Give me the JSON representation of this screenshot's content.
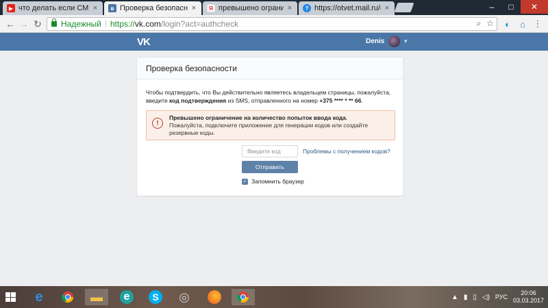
{
  "browser": {
    "tabs": [
      {
        "title": "что делать если СМС ко",
        "favicon_color": "#e62117",
        "active": false
      },
      {
        "title": "Проверка безопасност",
        "favicon_color": "#4a76a8",
        "active": true
      },
      {
        "title": "превышено ограничени",
        "favicon_color": "#ffffff",
        "active": false
      },
      {
        "title": "https://otvet.mail.ru/que",
        "favicon_color": "#1e88e5",
        "active": false
      }
    ],
    "tab_close": "×",
    "window": {
      "minimize": "–",
      "maximize": "□",
      "close": "✕"
    },
    "address": {
      "secure_label": "Надежный",
      "scheme": "https://",
      "host": "vk.com",
      "path": "/login?act=authcheck"
    }
  },
  "vk": {
    "logo": "VK",
    "user_name": "Denis",
    "page_title": "Проверка безопасности",
    "message_1": "Чтобы подтвердить, что Вы действительно являетесь владельцем страницы, пожалуйста, введите",
    "message_bold_code": "код подтверждения",
    "message_2": " из SMS, отправленного на номер ",
    "message_phone": "+375 **** * ** 66",
    "message_end": ".",
    "error_title": "Превышено ограничение на количество попыток ввода кода",
    "error_title_end": ".",
    "error_text": "Пожалуйста, подключите приложение для генерации кодов или создайте резервные коды.",
    "error_icon": "!",
    "code_placeholder": "Введите код",
    "problems_link": "Проблемы с получением кодов?",
    "send_button": "Отправить",
    "remember_label": "Запомнить браузер",
    "remember_checked": true
  },
  "taskbar": {
    "language": "РУС",
    "time": "20:06",
    "date": "03.03.2017"
  },
  "colors": {
    "vk_blue": "#4a76a8",
    "button": "#5e81a8",
    "error_bg": "#fbefe9",
    "link": "#2a5885"
  }
}
